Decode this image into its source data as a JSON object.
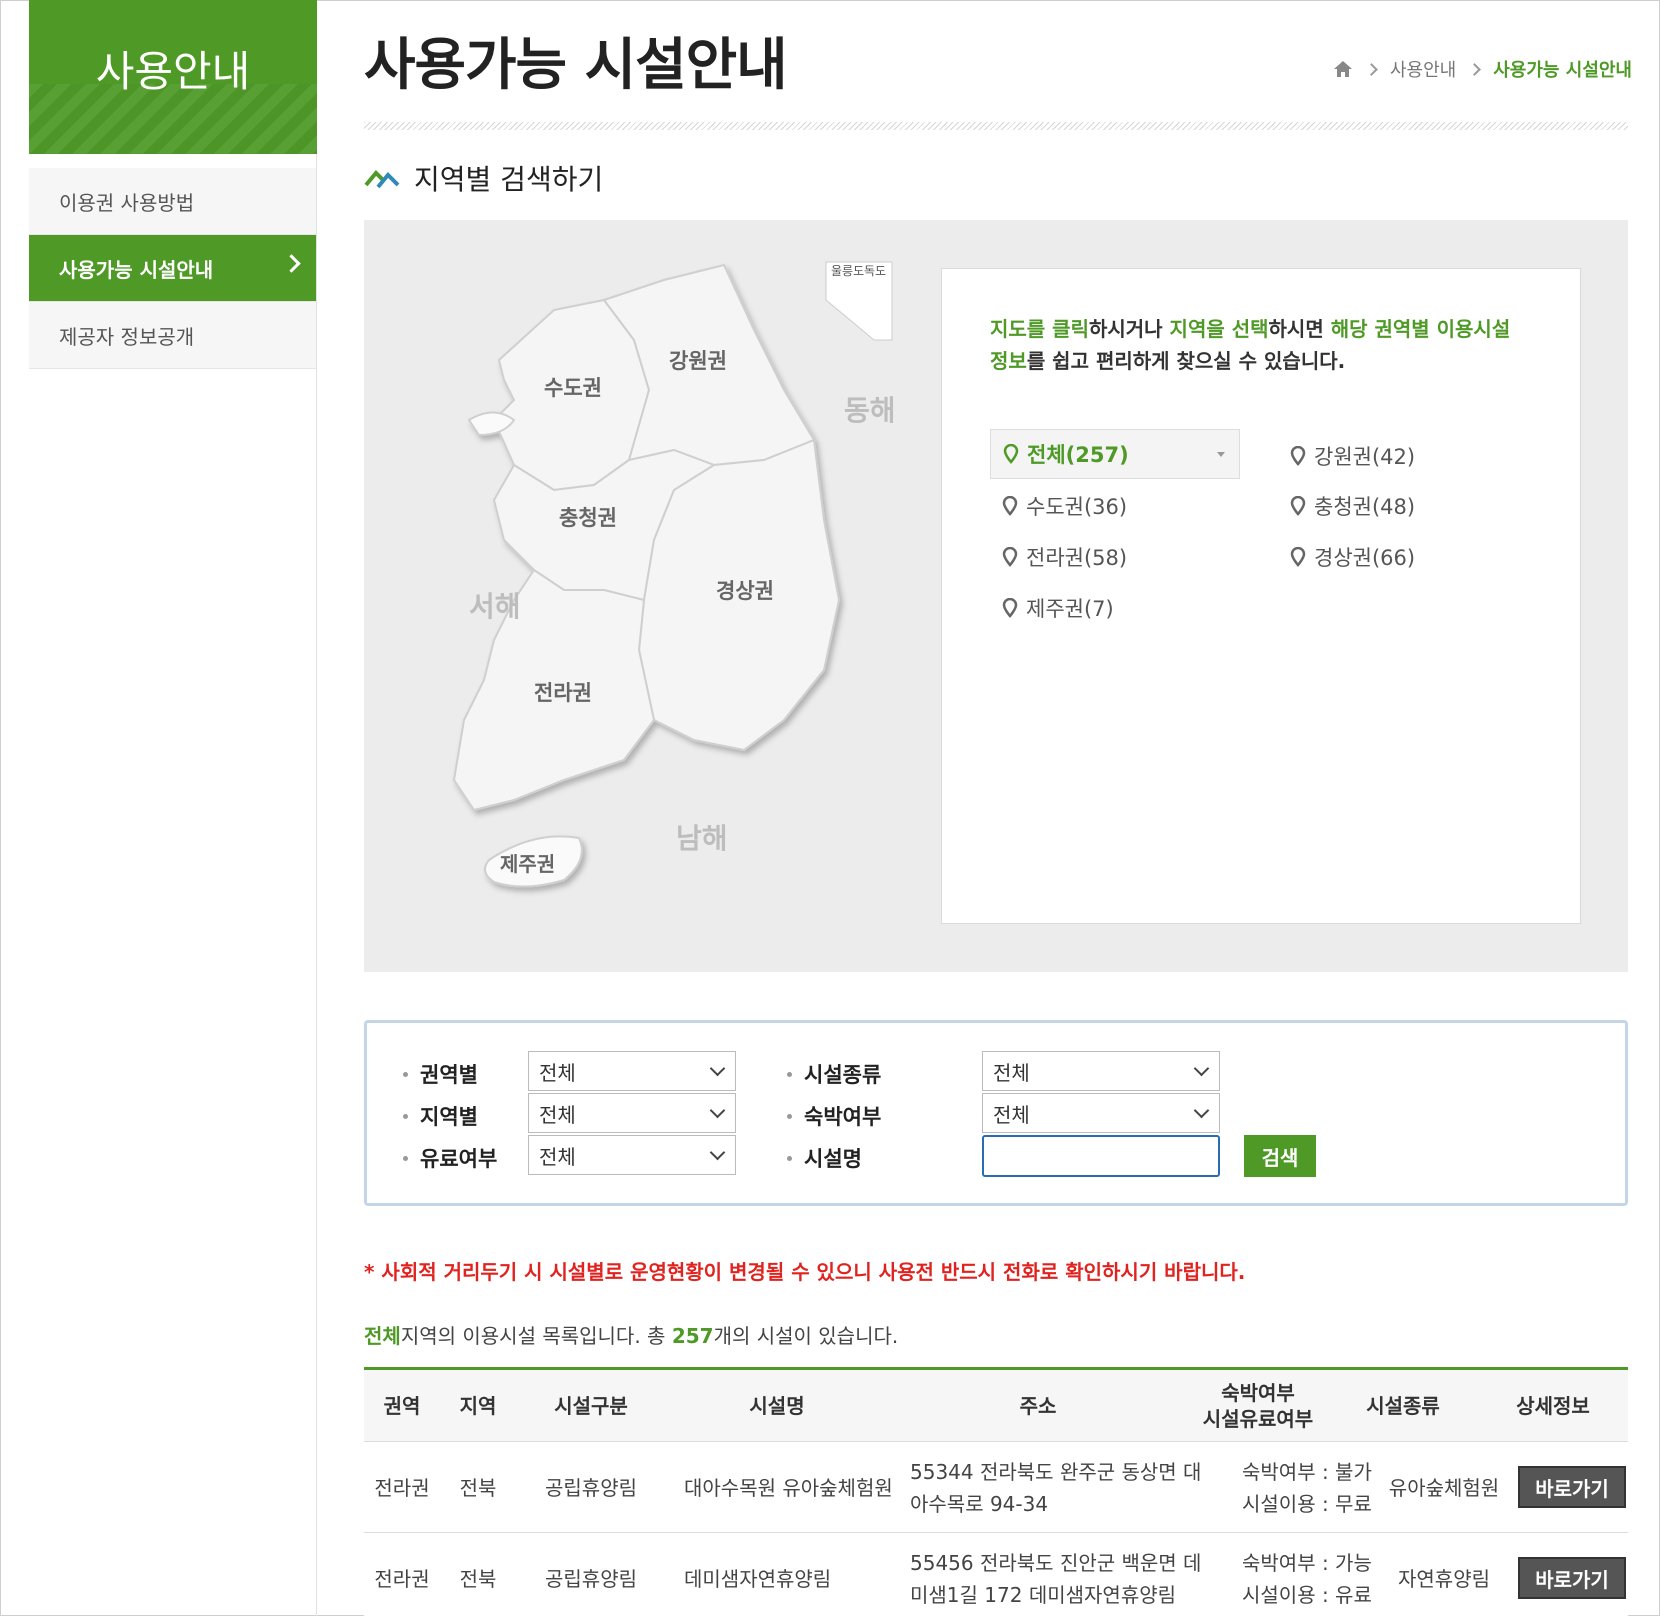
{
  "sidebar": {
    "title": "사용안내",
    "items": [
      {
        "label": "이용권 사용방법"
      },
      {
        "label": "사용가능 시설안내"
      },
      {
        "label": "제공자 정보공개"
      }
    ]
  },
  "header": {
    "title": "사용가능 시설안내",
    "breadcrumb": [
      "사용안내",
      "사용가능 시설안내"
    ]
  },
  "section": {
    "title": "지역별 검색하기"
  },
  "map": {
    "regions": [
      "수도권",
      "강원권",
      "충청권",
      "경상권",
      "전라권",
      "제주권"
    ],
    "seas": [
      "동해",
      "서해",
      "남해"
    ],
    "inset_labels": [
      "울릉도",
      "독도"
    ]
  },
  "info": {
    "text_parts": [
      "지도를 클릭",
      "하시거나 ",
      "지역을 선택",
      "하시면 ",
      "해당 권역별 이용시설 정보",
      "를 쉽고 편리하게 찾으실 수 있습니다."
    ],
    "regions": [
      {
        "label": "전체(257)"
      },
      {
        "label": "강원권(42)"
      },
      {
        "label": "수도권(36)"
      },
      {
        "label": "충청권(48)"
      },
      {
        "label": "전라권(58)"
      },
      {
        "label": "경상권(66)"
      },
      {
        "label": "제주권(7)"
      }
    ]
  },
  "search": {
    "labels": {
      "area": "권역별",
      "region": "지역별",
      "paid": "유료여부",
      "type": "시설종류",
      "lodging": "숙박여부",
      "name": "시설명"
    },
    "values": {
      "area": "전체",
      "region": "전체",
      "paid": "전체",
      "type": "전체",
      "lodging": "전체",
      "name": ""
    },
    "button": "검색"
  },
  "notice": "* 사회적 거리두기 시 시설별로 운영현황이 변경될 수 있으니 사용전 반드시 전화로 확인하시기 바랍니다.",
  "summary": {
    "region": "전체",
    "text1": "지역의 이용시설 목록입니다. 총 ",
    "count": "257",
    "text2": "개의 시설이 있습니다."
  },
  "table": {
    "headers": [
      "권역",
      "지역",
      "시설구분",
      "시설명",
      "주소",
      "숙박여부",
      "시설유료여부",
      "시설종류",
      "상세정보"
    ],
    "rows": [
      {
        "area": "전라권",
        "region": "전북",
        "category": "공립휴양림",
        "name": "대아수목원 유아숲체험원",
        "address": "55344 전라북도 완주군 동상면 대아수목로 94-34",
        "lodging": "숙박여부 : 불가",
        "fee": "시설이용 : 무료",
        "type": "유아숲체험원",
        "button": "바로가기"
      },
      {
        "area": "전라권",
        "region": "전북",
        "category": "공립휴양림",
        "name": "데미샘자연휴양림",
        "address": "55456 전라북도 진안군 백운면 데미샘1길 172 데미샘자연휴양림",
        "lodging": "숙박여부 : 가능",
        "fee": "시설이용 : 유료",
        "type": "자연휴양림",
        "button": "바로가기"
      }
    ]
  },
  "colors": {
    "brand_green": "#4f9a27",
    "notice_red": "#e0231f",
    "focus_blue": "#2b6cb0"
  }
}
